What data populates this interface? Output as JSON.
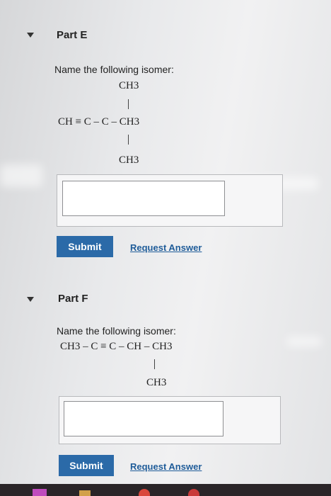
{
  "partE": {
    "title": "Part E",
    "prompt": "Name the following isomer:",
    "top": "CH3",
    "main": "CH ≡ C – C – CH3",
    "bottom": "CH3",
    "input_value": "",
    "submit_label": "Submit",
    "request_label": "Request Answer"
  },
  "partF": {
    "title": "Part F",
    "prompt": "Name the following isomer:",
    "main": "CH3 – C ≡ C – CH – CH3",
    "bottom": "CH3",
    "input_value": "",
    "submit_label": "Submit",
    "request_label": "Request Answer"
  }
}
